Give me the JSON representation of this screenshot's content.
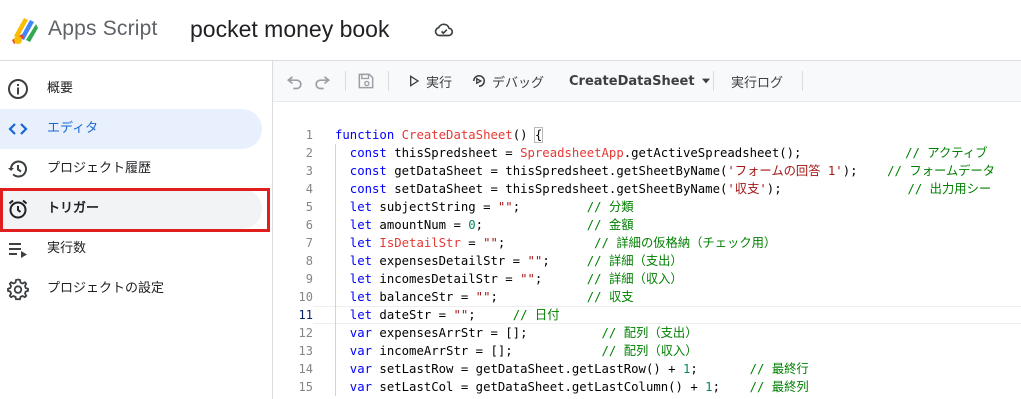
{
  "header": {
    "app_name": "Apps Script",
    "project_title": "pocket money book"
  },
  "sidebar": {
    "items": [
      {
        "label": "概要",
        "icon": "info-icon"
      },
      {
        "label": "エディタ",
        "icon": "code-icon"
      },
      {
        "label": "プロジェクト履歴",
        "icon": "history-icon"
      },
      {
        "label": "トリガー",
        "icon": "alarm-clock-icon"
      },
      {
        "label": "実行数",
        "icon": "executions-icon"
      },
      {
        "label": "プロジェクトの設定",
        "icon": "settings-gear-icon"
      }
    ],
    "active_index": 1,
    "highlighted_index": 3
  },
  "toolbar": {
    "run_label": "実行",
    "debug_label": "デバッグ",
    "function_select": "CreateDataSheet",
    "log_label": "実行ログ"
  },
  "editor": {
    "current_line": 11,
    "lines": [
      {
        "n": 1,
        "tokens": [
          [
            "kw",
            "function "
          ],
          [
            "fnr",
            "CreateDataSheet"
          ],
          [
            "pl",
            "() "
          ],
          [
            "pl",
            "{"
          ]
        ]
      },
      {
        "n": 2,
        "tokens": [
          [
            "kw",
            "  const "
          ],
          [
            "pl",
            "thisSpredsheet = "
          ],
          [
            "cls",
            "SpreadsheetApp"
          ],
          [
            "pl",
            "."
          ],
          [
            "pl",
            "getActiveSpreadsheet"
          ],
          [
            "pl",
            "();"
          ],
          [
            "cm",
            "              // アクティブ"
          ]
        ]
      },
      {
        "n": 3,
        "tokens": [
          [
            "kw",
            "  const "
          ],
          [
            "pl",
            "getDataSheet = thisSpredsheet.getSheetByName("
          ],
          [
            "str",
            "'フォームの回答 1'"
          ],
          [
            "pl",
            ");"
          ],
          [
            "cm",
            "    // フォームデータ"
          ]
        ]
      },
      {
        "n": 4,
        "tokens": [
          [
            "kw",
            "  const "
          ],
          [
            "pl",
            "setDataSheet = thisSpredsheet.getSheetByName("
          ],
          [
            "str",
            "'収支'"
          ],
          [
            "pl",
            ");"
          ],
          [
            "cm",
            "                 // 出力用シー"
          ]
        ]
      },
      {
        "n": 5,
        "tokens": [
          [
            "kw",
            "  let "
          ],
          [
            "pl",
            "subjectString = "
          ],
          [
            "str",
            "\"\""
          ],
          [
            "pl",
            ";"
          ],
          [
            "cm",
            "         // 分類"
          ]
        ]
      },
      {
        "n": 6,
        "tokens": [
          [
            "kw",
            "  let "
          ],
          [
            "pl",
            "amountNum = "
          ],
          [
            "num",
            "0"
          ],
          [
            "pl",
            ";"
          ],
          [
            "cm",
            "              // 金額"
          ]
        ]
      },
      {
        "n": 7,
        "tokens": [
          [
            "kw",
            "  let "
          ],
          [
            "fnr",
            "IsDetailStr"
          ],
          [
            "pl",
            " = "
          ],
          [
            "str",
            "\"\""
          ],
          [
            "pl",
            ";"
          ],
          [
            "cm",
            "            // 詳細の仮格納（チェック用）"
          ]
        ]
      },
      {
        "n": 8,
        "tokens": [
          [
            "kw",
            "  let "
          ],
          [
            "pl",
            "expensesDetailStr = "
          ],
          [
            "str",
            "\"\""
          ],
          [
            "pl",
            ";"
          ],
          [
            "cm",
            "     // 詳細（支出）"
          ]
        ]
      },
      {
        "n": 9,
        "tokens": [
          [
            "kw",
            "  let "
          ],
          [
            "pl",
            "incomesDetailStr = "
          ],
          [
            "str",
            "\"\""
          ],
          [
            "pl",
            ";"
          ],
          [
            "cm",
            "      // 詳細（収入）"
          ]
        ]
      },
      {
        "n": 10,
        "tokens": [
          [
            "kw",
            "  let "
          ],
          [
            "pl",
            "balanceStr = "
          ],
          [
            "str",
            "\"\""
          ],
          [
            "pl",
            ";"
          ],
          [
            "cm",
            "            // 収支"
          ]
        ]
      },
      {
        "n": 11,
        "tokens": [
          [
            "kw",
            "  let "
          ],
          [
            "pl",
            "dateStr = "
          ],
          [
            "str",
            "\"\""
          ],
          [
            "pl",
            ";"
          ],
          [
            "cm",
            "     // 日付"
          ]
        ]
      },
      {
        "n": 12,
        "tokens": [
          [
            "kw",
            "  var "
          ],
          [
            "pl",
            "expensesArrStr = [];"
          ],
          [
            "cm",
            "          // 配列（支出）"
          ]
        ]
      },
      {
        "n": 13,
        "tokens": [
          [
            "kw",
            "  var "
          ],
          [
            "pl",
            "incomeArrStr = [];"
          ],
          [
            "cm",
            "            // 配列（収入）"
          ]
        ]
      },
      {
        "n": 14,
        "tokens": [
          [
            "kw",
            "  var "
          ],
          [
            "pl",
            "setLastRow = getDataSheet.getLastRow() + "
          ],
          [
            "num",
            "1"
          ],
          [
            "pl",
            ";"
          ],
          [
            "cm",
            "       // 最終行"
          ]
        ]
      },
      {
        "n": 15,
        "tokens": [
          [
            "kw",
            "  var "
          ],
          [
            "pl",
            "setLastCol = getDataSheet.getLastColumn() + "
          ],
          [
            "num",
            "1"
          ],
          [
            "pl",
            ";"
          ],
          [
            "cm",
            "    // 最終列"
          ]
        ]
      }
    ]
  },
  "colors": {
    "accent": "#1967d2",
    "active_bg": "#e8f0fe",
    "highlight_border": "#e01e1e"
  }
}
